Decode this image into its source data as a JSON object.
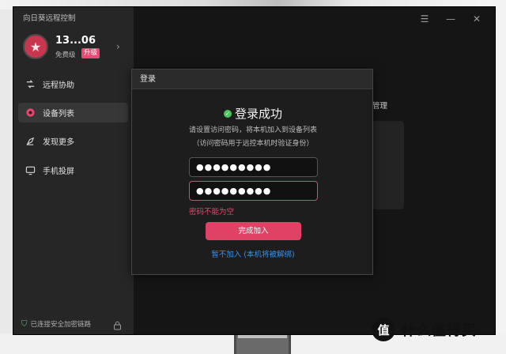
{
  "app": {
    "title": "向日葵远程控制"
  },
  "user": {
    "id": "13...06",
    "tier": "免费级",
    "upgrade": "升级",
    "avatar_icon": "star-icon"
  },
  "sidebar": {
    "items": [
      {
        "label": "远程协助",
        "icon": "remote-assist-icon",
        "active": false
      },
      {
        "label": "设备列表",
        "icon": "device-list-icon",
        "active": true
      },
      {
        "label": "发现更多",
        "icon": "discover-icon",
        "active": false
      },
      {
        "label": "手机投屏",
        "icon": "screen-cast-icon",
        "active": false
      }
    ],
    "footer": "已连接安全加密链路"
  },
  "background": {
    "partial_label": "管理"
  },
  "dialog": {
    "title": "登录",
    "success": "登录成功",
    "desc1": "请设置访问密码，将本机加入到设备列表",
    "desc2": "（访问密码用于远控本机时验证身份）",
    "password": "●●●●●●●●●",
    "confirm_password": "●●●●●●●●●",
    "error": "密码不能为空",
    "submit": "完成加入",
    "skip": "暂不加入 (本机将被解绑)"
  },
  "watermark": {
    "logo": "值",
    "text": "什么值得买"
  },
  "colors": {
    "accent": "#df4265",
    "success": "#4cc45e",
    "link": "#3b90e8",
    "error": "#e8466d"
  }
}
